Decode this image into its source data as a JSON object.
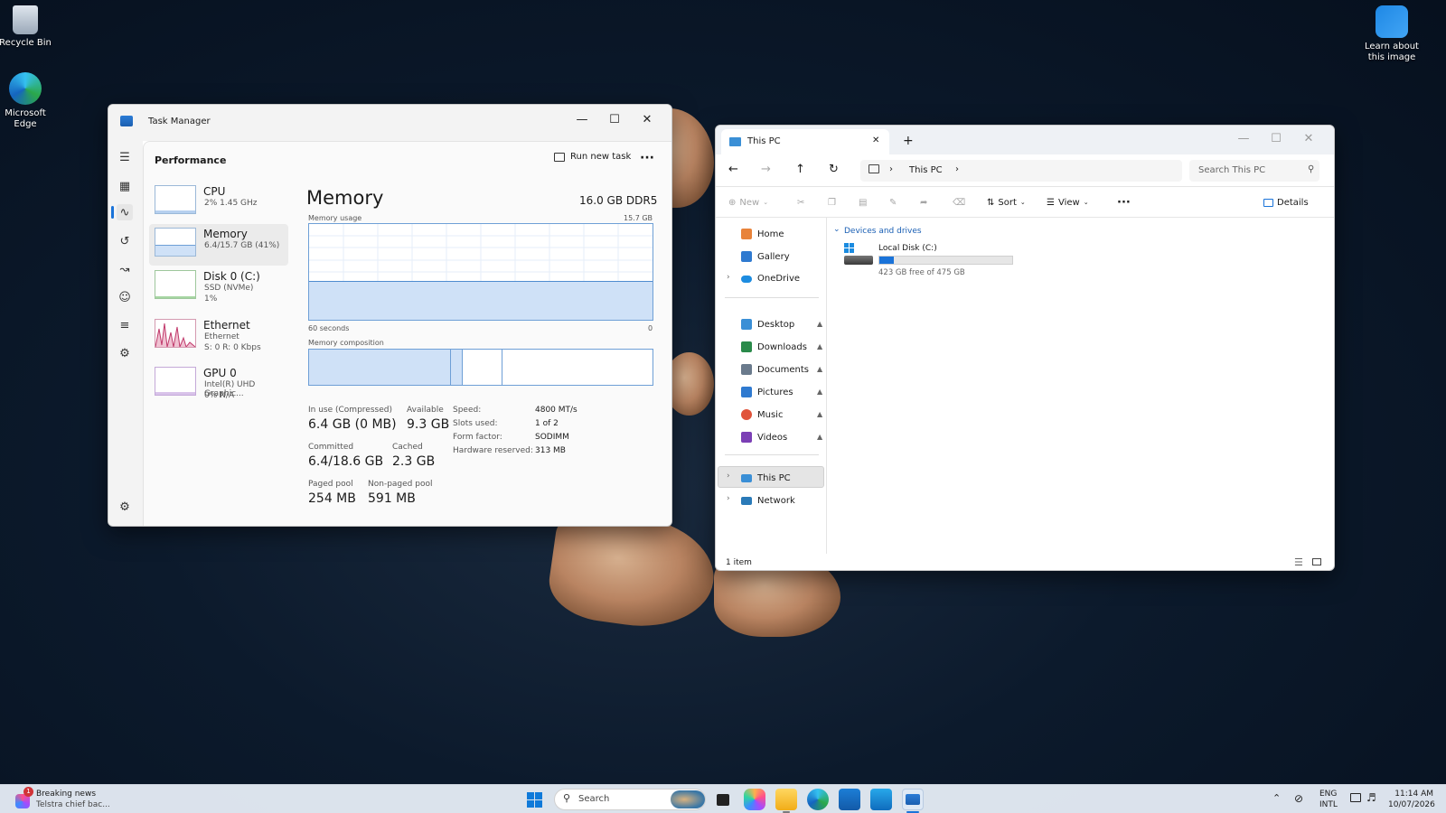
{
  "desktop": {
    "recycle_bin": "Recycle Bin",
    "edge": "Microsoft Edge",
    "learn_about": "Learn about this image"
  },
  "task_manager": {
    "title": "Task Manager",
    "page_header": "Performance",
    "run_new_task": "Run new task",
    "more": "···",
    "sidebar": [
      {
        "name": "CPU",
        "sub1": "2% 1.45 GHz",
        "sub2": ""
      },
      {
        "name": "Memory",
        "sub1": "6.4/15.7 GB (41%)",
        "sub2": ""
      },
      {
        "name": "Disk 0 (C:)",
        "sub1": "SSD (NVMe)",
        "sub2": "1%"
      },
      {
        "name": "Ethernet",
        "sub1": "Ethernet",
        "sub2": "S: 0 R: 0 Kbps"
      },
      {
        "name": "GPU 0",
        "sub1": "Intel(R) UHD Graphic...",
        "sub2": "0% N/A"
      }
    ],
    "main": {
      "heading": "Memory",
      "capacity": "16.0 GB DDR5",
      "usage_label": "Memory usage",
      "usage_max": "15.7 GB",
      "time_label": "60 seconds",
      "time_zero": "0",
      "usage_fraction": 0.41,
      "composition_label": "Memory composition",
      "stats": {
        "in_use_label": "In use (Compressed)",
        "in_use": "6.4 GB (0 MB)",
        "available_label": "Available",
        "available": "9.3 GB",
        "committed_label": "Committed",
        "committed": "6.4/18.6 GB",
        "cached_label": "Cached",
        "cached": "2.3 GB",
        "paged_label": "Paged pool",
        "paged": "254 MB",
        "nonpaged_label": "Non-paged pool",
        "nonpaged": "591 MB"
      },
      "specs": [
        {
          "label": "Speed:",
          "value": "4800 MT/s"
        },
        {
          "label": "Slots used:",
          "value": "1 of 2"
        },
        {
          "label": "Form factor:",
          "value": "SODIMM"
        },
        {
          "label": "Hardware reserved:",
          "value": "313 MB"
        }
      ]
    }
  },
  "explorer": {
    "tab_title": "This PC",
    "address": "This PC",
    "search_placeholder": "Search This PC",
    "toolbar": {
      "new": "New",
      "sort": "Sort",
      "view": "View",
      "more": "···",
      "details": "Details"
    },
    "nav": {
      "home": "Home",
      "gallery": "Gallery",
      "onedrive": "OneDrive",
      "quick": [
        {
          "label": "Desktop",
          "icon": "desktop-folder-icon",
          "color": "#3a8fd6"
        },
        {
          "label": "Downloads",
          "icon": "download-icon",
          "color": "#2a8a4a"
        },
        {
          "label": "Documents",
          "icon": "documents-icon",
          "color": "#6a7a8c"
        },
        {
          "label": "Pictures",
          "icon": "pictures-icon",
          "color": "#2f7ad0"
        },
        {
          "label": "Music",
          "icon": "music-icon",
          "color": "#e0533a"
        },
        {
          "label": "Videos",
          "icon": "videos-icon",
          "color": "#7b3fb5"
        }
      ],
      "this_pc": "This PC",
      "network": "Network"
    },
    "section": "Devices and drives",
    "drive": {
      "name": "Local Disk (C:)",
      "free": "423 GB free of 475 GB",
      "used_fraction": 0.11
    },
    "status": "1 item"
  },
  "taskbar": {
    "news_title": "Breaking news",
    "news_sub": "Telstra chief bac...",
    "news_badge": "1",
    "search": "Search",
    "lang1": "ENG",
    "lang2": "INTL",
    "time": "11:14 AM",
    "date": "10/07/2026"
  }
}
